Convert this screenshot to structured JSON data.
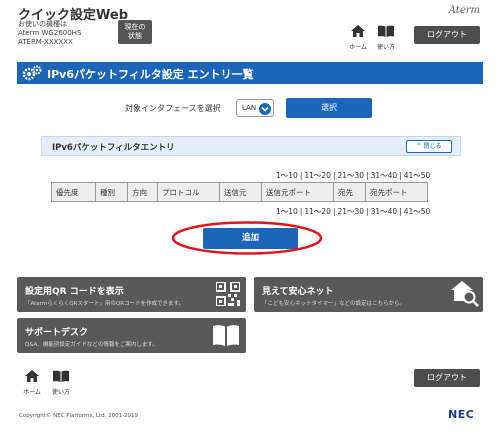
{
  "header": {
    "app_title": "クイック設定Web",
    "device_line1": "お使いの機種は",
    "device_line2": "Aterm WG2600HS",
    "device_line3": "ATERM-XXXXXX",
    "status_line1": "現在の",
    "status_line2": "状態",
    "brand": "Aterm",
    "home_label": "ホーム",
    "manual_label": "使い方",
    "logout_label": "ログアウト"
  },
  "page": {
    "title": "IPv6パケットフィルタ設定 エントリ一覧"
  },
  "interface": {
    "label": "対象インタフェースを選択",
    "selected": "LAN",
    "select_button": "選択"
  },
  "section": {
    "title": "IPv6パケットフィルタエントリ",
    "collapse_label": "閉じる"
  },
  "pager": [
    "1～10",
    "11～20",
    "21～30",
    "31～40",
    "41～50"
  ],
  "table": {
    "columns": [
      "優先度",
      "種別",
      "方向",
      "プロトコル",
      "送信元",
      "送信元ポート",
      "宛先",
      "宛先ポート"
    ]
  },
  "add_button": "追加",
  "tiles": {
    "qr": {
      "title": "設定用QR コードを表示",
      "desc": "「AtermらくらくQRスタート」用のQRコードを作成できます。"
    },
    "safe_net": {
      "title": "見えて安心ネット",
      "desc": "「こども安心ネットタイマー」などの設定はこちらから。"
    },
    "support": {
      "title": "サポートデスク",
      "desc": "Q&A、機能別設定ガイドなどの情報をご案内します。"
    }
  },
  "footer": {
    "home_label": "ホーム",
    "manual_label": "使い方",
    "logout_label": "ログアウト",
    "copyright": "Copyright© NEC Platforms, Ltd. 2001-2019",
    "logo": "NEC"
  },
  "colors": {
    "primary": "#1b66b8",
    "tile": "#595959",
    "highlight": "#e0141e"
  }
}
